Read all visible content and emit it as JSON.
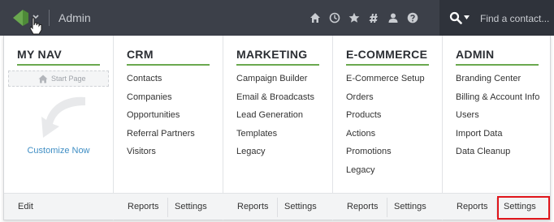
{
  "header": {
    "app_title": "Admin",
    "search_placeholder": "Find a contact...",
    "icons": [
      "home-icon",
      "clock-icon",
      "star-icon",
      "hashtag-icon",
      "user-icon",
      "help-icon"
    ],
    "colors": {
      "bar": "#3c4049",
      "search_bg": "#2f333b",
      "accent": "#6aa84f",
      "highlight": "#e0151b"
    }
  },
  "columns": [
    {
      "id": "my-nav",
      "heading": "MY NAV",
      "start_page": "Start Page",
      "customize": "Customize Now",
      "links": [],
      "footer": [
        "Edit"
      ]
    },
    {
      "id": "crm",
      "heading": "CRM",
      "links": [
        "Contacts",
        "Companies",
        "Opportunities",
        "Referral Partners",
        "Visitors"
      ],
      "footer": [
        "Reports",
        "Settings"
      ]
    },
    {
      "id": "marketing",
      "heading": "MARKETING",
      "links": [
        "Campaign Builder",
        "Email & Broadcasts",
        "Lead Generation",
        "Templates",
        "Legacy"
      ],
      "footer": [
        "Reports",
        "Settings"
      ]
    },
    {
      "id": "ecommerce",
      "heading": "E-COMMERCE",
      "links": [
        "E-Commerce Setup",
        "Orders",
        "Products",
        "Actions",
        "Promotions",
        "Legacy"
      ],
      "footer": [
        "Reports",
        "Settings"
      ]
    },
    {
      "id": "admin",
      "heading": "ADMIN",
      "links": [
        "Branding Center",
        "Billing & Account Info",
        "Users",
        "Import Data",
        "Data Cleanup"
      ],
      "footer": [
        "Reports",
        "Settings"
      ]
    }
  ]
}
